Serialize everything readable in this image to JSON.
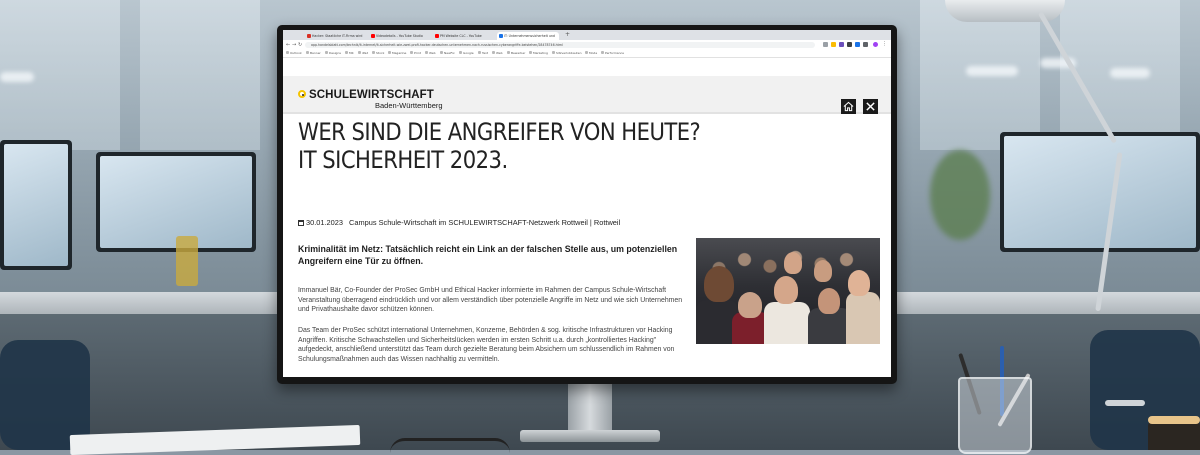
{
  "browser": {
    "tabs": [
      {
        "label": "Hacker: Staatliche IT-Firma wird",
        "color": "#d93025",
        "active": false
      },
      {
        "label": "Videodetails - YouTube Studio",
        "color": "#ff0000",
        "active": false
      },
      {
        "label": "PM Website CLC - YouTube",
        "color": "#ff0000",
        "active": false
      },
      {
        "label": "IT: Unternehmenssicherheit und",
        "color": "#1a73e8",
        "active": true
      }
    ],
    "url": "app.handelsblatt.com/technik/it-internet/it-sicherheit-wie-zwei-profi-hacker-deutschen-unternehmen-nach-russischen-cyberangriffe-beistehen/28478746.html",
    "bookmarks": [
      "Outlook",
      "Banner",
      "Designs",
      "MK",
      "iPad",
      "Stock",
      "Magazine",
      "Print",
      "Web",
      "NewFix",
      "Google",
      "Text",
      "Web",
      "Bewerber",
      "Marketing",
      "Sitzverlobbauten",
      "Mode",
      "Performance"
    ]
  },
  "site": {
    "logo": "SCHULEWIRTSCHAFT",
    "logo_sub": "Baden-Württemberg",
    "headline": "WER SIND DIE ANGREIFER VON HEUTE? IT SICHERHEIT 2023.",
    "date": "30.01.2023",
    "location": "Campus Schule-Wirtschaft im SCHULEWIRTSCHAFT-Netzwerk Rottweil | Rottweil",
    "lead": "Kriminalität im Netz: Tatsächlich reicht ein Link an der falschen Stelle aus, um potenziellen Angreifern eine Tür zu öffnen.",
    "paragraph1": "Immanuel Bär, Co-Founder der ProSec GmbH und Ethical Hacker informierte im Rahmen der Campus Schule-Wirtschaft Veranstaltung überragend eindrücklich und vor allem verständlich über potenzielle Angriffe im Netz und wie sich Unternehmen und Privathaushalte davor schützen können.",
    "paragraph2": "Das Team der ProSec schützt international Unternehmen, Konzerne, Behörden & sog. kritische Infrastrukturen vor Hacking Angriffen. Kritische Schwachstellen und Sicherheitslücken werden im ersten Schritt u.a. durch „kontrolliertes Hacking\" aufgedeckt, anschließend unterstützt das Team durch gezielte Beratung beim Absichern um schlussendlich im Rahmen von Schulungsmaßnahmen auch das Wissen nachhaltig zu vermitteln."
  },
  "icons": {
    "home": "home-icon",
    "close": "close-icon",
    "calendar": "calendar-icon"
  },
  "colors": {
    "logo_ring": "#f5c400",
    "text": "#222222",
    "header_bg": "#f1f1f1"
  }
}
